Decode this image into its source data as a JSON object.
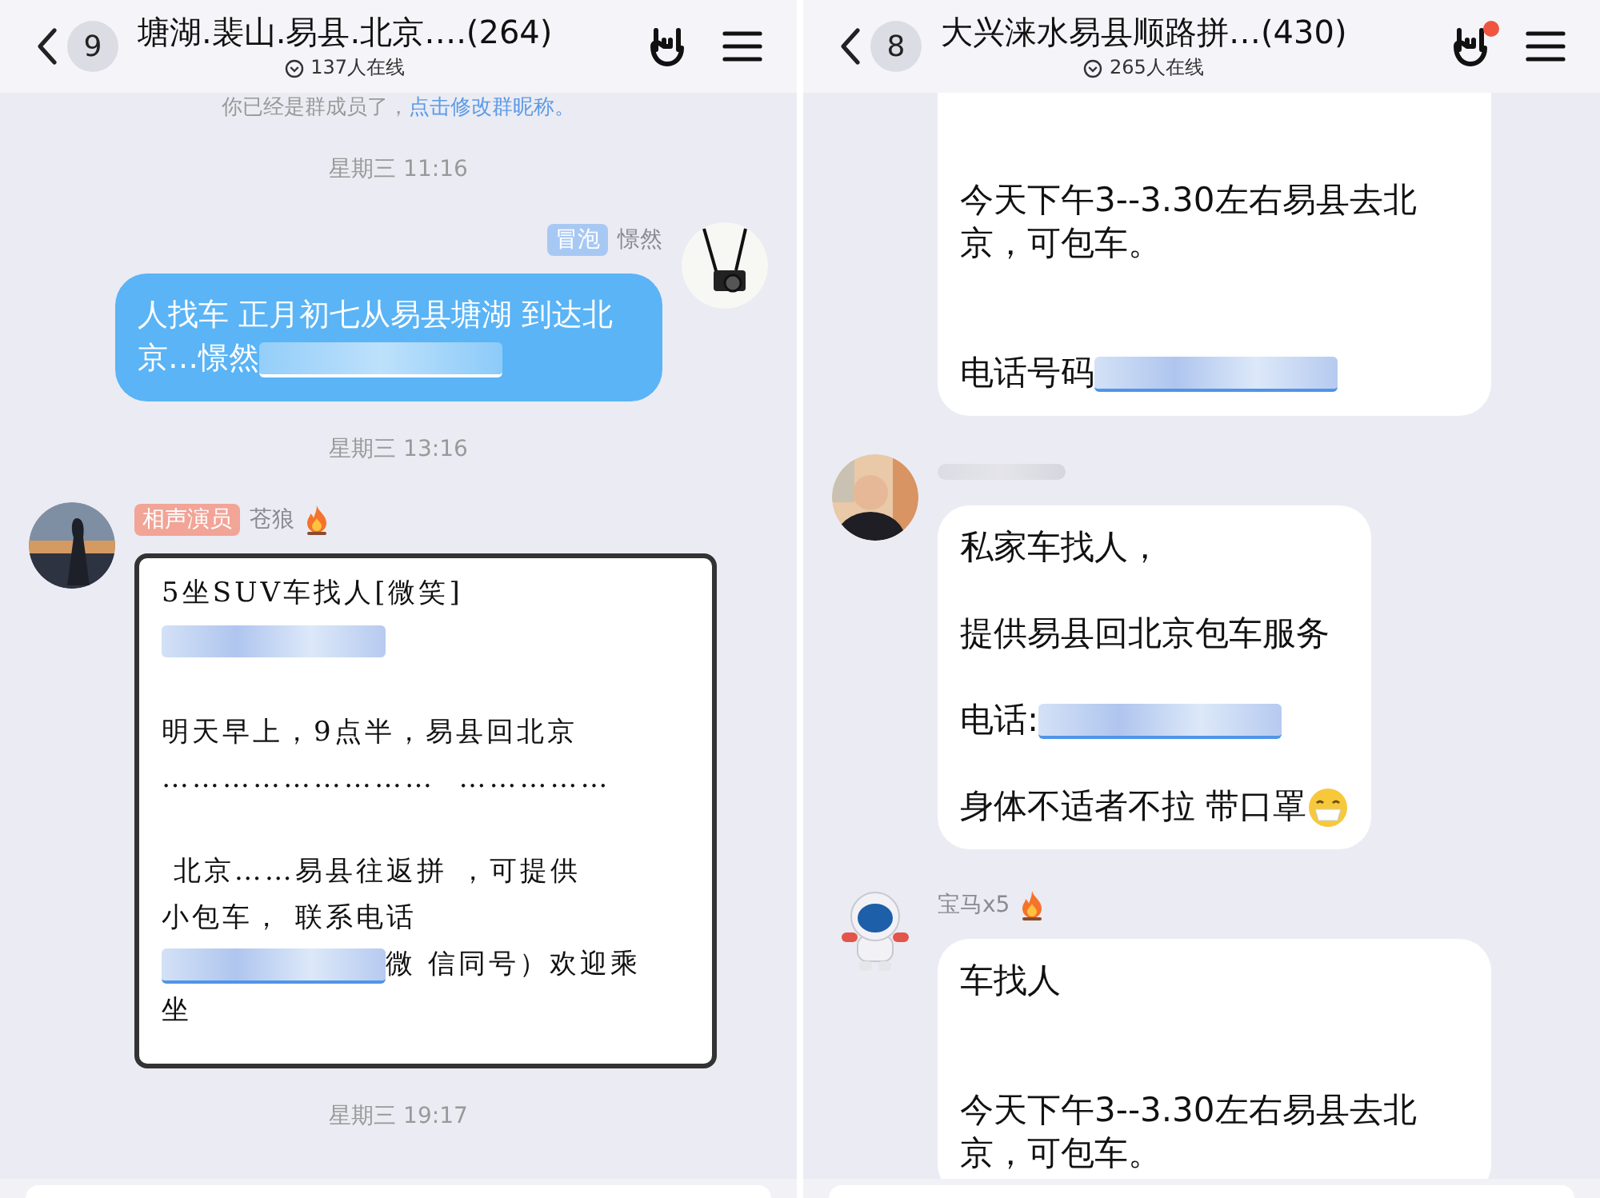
{
  "panels": [
    {
      "header": {
        "unread": "9",
        "title": "塘湖.裴山.易县.北京….(264)",
        "online": "137人在线"
      },
      "messages": [
        {
          "kind": "notice",
          "text": "你已经是群成员了，",
          "link": "点击修改群昵称。"
        },
        {
          "kind": "time",
          "text": "星期三 11:16"
        },
        {
          "kind": "outgoing",
          "avatar": {
            "kind": "camera"
          },
          "tag": {
            "text": "冒泡",
            "color": "#a8c8f4"
          },
          "name": "憬然",
          "bubble": {
            "kind": "text",
            "paragraphs": [
              [
                [
                  {
                    "kind": "text",
                    "text": "人找车 正月初七从易县塘湖 到达北京…憬然"
                  },
                  {
                    "kind": "blurred_link"
                  }
                ]
              ]
            ]
          }
        },
        {
          "kind": "time",
          "text": "星期三 13:16"
        },
        {
          "kind": "incoming",
          "avatar": {
            "kind": "sunset_photo"
          },
          "tag": {
            "text": "相声演员",
            "color": "#f2a497"
          },
          "name": "苍狼",
          "flame": true,
          "bubble": {
            "paragraphs": [
              [
                [
                  {
                    "kind": "text",
                    "text": "5坐SUV车找人[微笑]"
                  }
                ],
                [
                  {
                    "kind": "blurred_text"
                  }
                ]
              ],
              [
                [
                  {
                    "kind": "text",
                    "text": "明天早上，9点半，易县回北京"
                  }
                ],
                [
                  {
                    "kind": "text",
                    "text": "………………………  ……………"
                  }
                ]
              ],
              [
                [
                  {
                    "kind": "text",
                    "text": " 北京……易县往返拼 ，可提供"
                  }
                ],
                [
                  {
                    "kind": "text",
                    "text": "小包车， 联系电话"
                  }
                ],
                [
                  {
                    "kind": "blurred_link"
                  },
                  {
                    "kind": "text",
                    "text": "微 信同号）欢迎乘"
                  }
                ],
                [
                  {
                    "kind": "text",
                    "text": "坐"
                  }
                ]
              ]
            ]
          }
        },
        {
          "kind": "time",
          "text": "星期三 19:17"
        }
      ]
    },
    {
      "header": {
        "unread": "8",
        "title": "大兴涞水易县顺路拼…(430)",
        "online": "265人在线",
        "notification_dot": true
      },
      "messages": [
        {
          "kind": "incoming",
          "continued": true,
          "bubble": {
            "kind": "text",
            "wide_gaps": true,
            "paragraphs": [
              [
                [
                  {
                    "kind": "text",
                    "text": "今天下午3--3.30左右易县去北京，可包车。"
                  }
                ]
              ],
              [
                [
                  {
                    "kind": "text",
                    "text": "电话号码"
                  },
                  {
                    "kind": "blurred_link"
                  }
                ]
              ]
            ]
          }
        },
        {
          "kind": "incoming",
          "avatar": {
            "kind": "person_photo"
          },
          "name_blurred": true,
          "bubble": {
            "kind": "text",
            "paragraphs": [
              [
                [
                  {
                    "kind": "text",
                    "text": "私家车找人，"
                  }
                ]
              ],
              [
                [
                  {
                    "kind": "text",
                    "text": "提供易县回北京包车服务"
                  }
                ]
              ],
              [
                [
                  {
                    "kind": "text",
                    "text": "电话:"
                  },
                  {
                    "kind": "blurred_link"
                  }
                ]
              ],
              [
                [
                  {
                    "kind": "text",
                    "text": "身体不适者不拉 带口罩"
                  },
                  {
                    "kind": "mask_emoji"
                  }
                ]
              ]
            ]
          }
        },
        {
          "kind": "incoming",
          "avatar": {
            "kind": "astronaut"
          },
          "name": "宝马x5",
          "flame": true,
          "bubble": {
            "kind": "text",
            "wide_gaps": true,
            "paragraphs": [
              [
                [
                  {
                    "kind": "text",
                    "text": "车找人"
                  }
                ]
              ],
              [
                [
                  {
                    "kind": "text",
                    "text": "今天下午3--3.30左右易县去北京，可包车。"
                  }
                ]
              ]
            ]
          }
        }
      ]
    }
  ]
}
